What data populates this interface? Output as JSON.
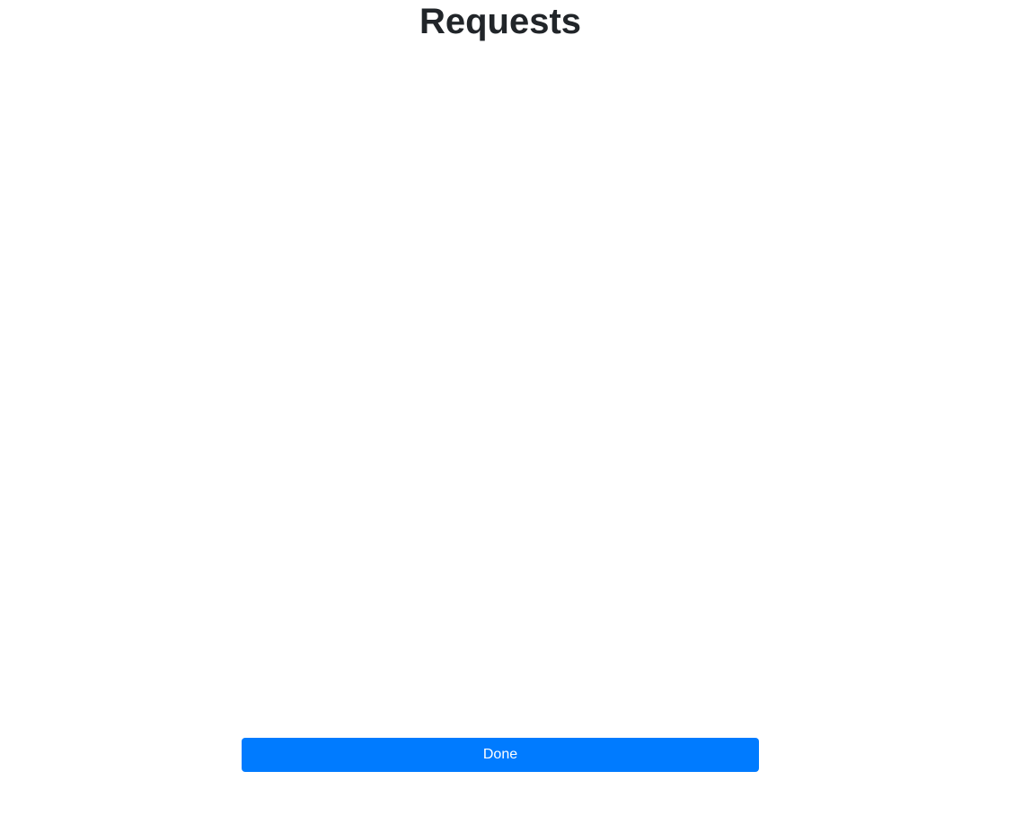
{
  "header": {
    "title": "Requests"
  },
  "requests": {
    "items": []
  },
  "footer": {
    "done_label": "Done"
  },
  "colors": {
    "primary_button": "#007bff",
    "title_text": "#212529",
    "background": "#ffffff"
  }
}
